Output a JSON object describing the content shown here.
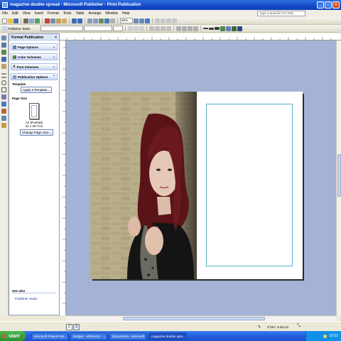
{
  "window": {
    "title": "magazine double spread - Microsoft Publisher - Print Publication"
  },
  "menu": {
    "items": [
      "File",
      "Edit",
      "View",
      "Insert",
      "Format",
      "Tools",
      "Table",
      "Arrange",
      "Window",
      "Help"
    ],
    "help_placeholder": "Type a question for help"
  },
  "toolbar": {
    "zoom": "50%",
    "task_pane_label": "Publisher Tasks"
  },
  "task_pane": {
    "title": "Format Publication",
    "sections": [
      "Page Options",
      "Color Schemes",
      "Font Schemes",
      "Publication Options"
    ],
    "template_label": "Template",
    "apply_template_button": "Apply a Template...",
    "page_size_label": "Page Size",
    "page_size_name": "A4 (Portrait)",
    "page_size_dims": "21 x 29.7cm",
    "change_page_size_button": "Change Page Size...",
    "see_also_label": "See also",
    "see_also_link": "Publisher Tasks"
  },
  "pages": {
    "nav": [
      "2",
      "3"
    ]
  },
  "status": {
    "position": "4\"267, 9.49 cm"
  },
  "taskbar": {
    "start_label": "start",
    "tasks": [
      "Microsoft PowerPoint ...",
      "Bridget - allnfwrdoc - ...",
      "Document3 - Microsoft ...",
      "magazine double spre..."
    ],
    "clock": "10:52"
  },
  "colors": {
    "titlebar": "#1448c8",
    "canvas": "#a4b2d6",
    "taskbar": "#235ee0",
    "start": "#2f8f2f"
  }
}
